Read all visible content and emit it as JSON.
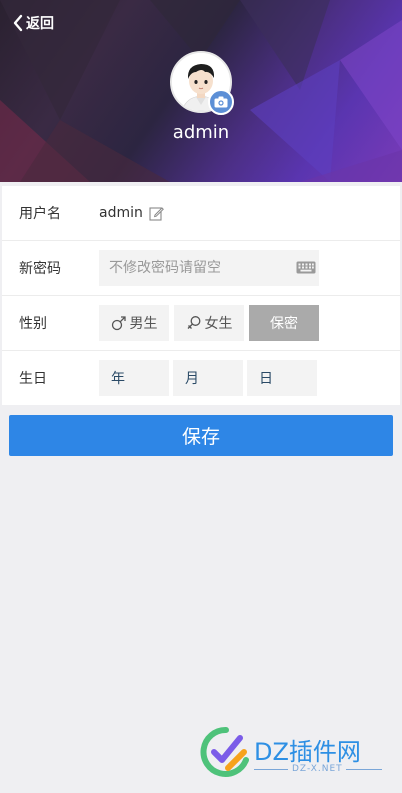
{
  "header": {
    "back_label": "返回",
    "username": "admin"
  },
  "form": {
    "username": {
      "label": "用户名",
      "value": "admin"
    },
    "password": {
      "label": "新密码",
      "placeholder": "不修改密码请留空"
    },
    "gender": {
      "label": "性别",
      "options": [
        "男生",
        "女生",
        "保密"
      ],
      "selected": "保密"
    },
    "birthday": {
      "label": "生日",
      "year": "年",
      "month": "月",
      "day": "日"
    }
  },
  "save_label": "保存",
  "watermark": {
    "brand": "DZ插件网",
    "domain": "DZ-X.NET"
  },
  "colors": {
    "accent": "#2e86e6",
    "selected_gender_bg": "#aaaaaa",
    "camera_badge": "#5c8fd6"
  }
}
